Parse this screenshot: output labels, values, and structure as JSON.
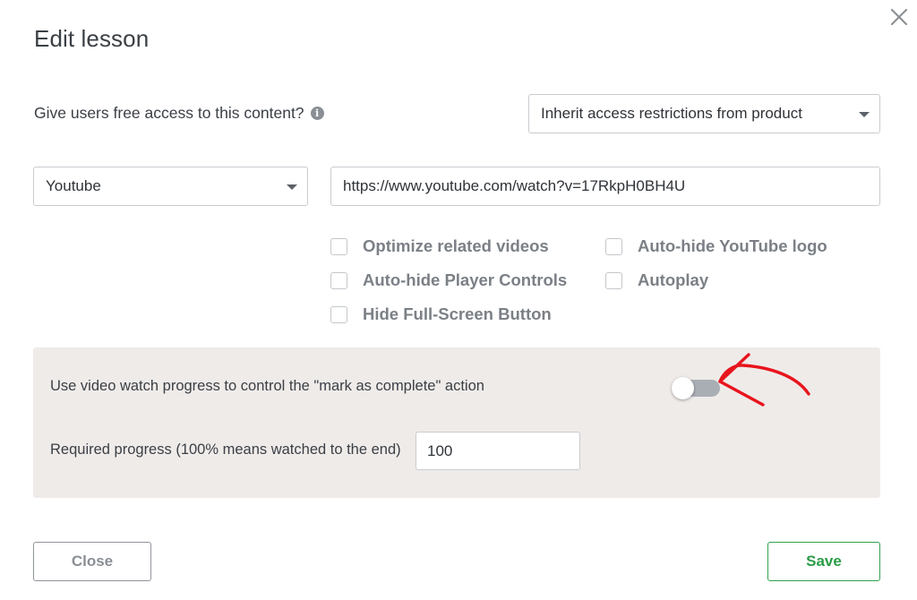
{
  "dialog": {
    "title": "Edit lesson"
  },
  "access": {
    "label": "Give users free access to this content?",
    "info_icon": "info-icon",
    "selected": "Inherit access restrictions from product"
  },
  "video": {
    "provider_selected": "Youtube",
    "url": "https://www.youtube.com/watch?v=17RkpH0BH4U"
  },
  "options": [
    {
      "label": "Optimize related videos",
      "checked": false
    },
    {
      "label": "Auto-hide Player Controls",
      "checked": false
    },
    {
      "label": "Hide Full-Screen Button",
      "checked": false
    },
    {
      "label": "Auto-hide YouTube logo",
      "checked": false
    },
    {
      "label": "Autoplay",
      "checked": false
    }
  ],
  "progress_panel": {
    "toggle_label": "Use video watch progress to control the \"mark as complete\" action",
    "toggle_on": false,
    "required_label": "Required progress (100% means watched to the end)",
    "required_value": "100"
  },
  "annotation": {
    "arrow_color": "#e8141c"
  },
  "buttons": {
    "close": "Close",
    "save": "Save"
  },
  "colors": {
    "save_accent": "#2a9c46",
    "panel_bg": "#efebe9"
  }
}
